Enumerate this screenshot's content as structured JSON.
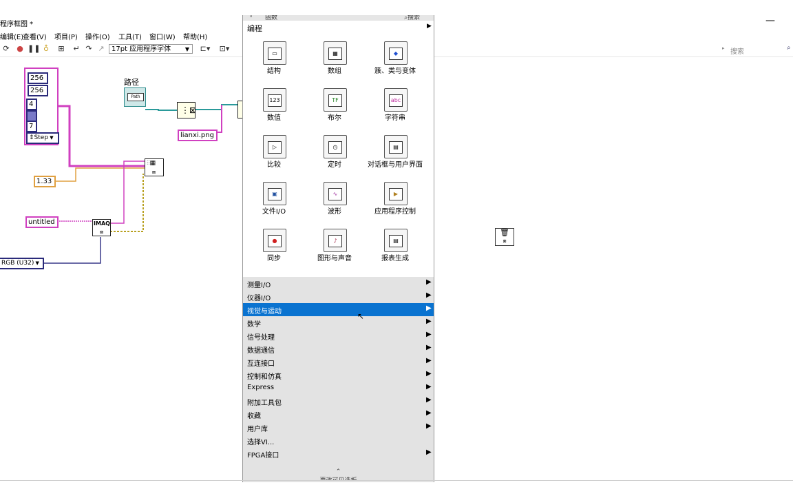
{
  "window": {
    "title": "程序框图 *",
    "minimize": "—"
  },
  "menu": [
    "编辑(E)",
    "查看(V)",
    "项目(P)",
    "操作(O)",
    "工具(T)",
    "窗口(W)",
    "帮助(H)"
  ],
  "toolbar": {
    "font": "17pt 应用程序字体",
    "search_placeholder": "搜索"
  },
  "diagram": {
    "cluster_values": [
      "256",
      "256",
      "4",
      "7"
    ],
    "step_label": "Step",
    "path_label": "路径",
    "path_node_text": "Path",
    "filename": "lianxi.png",
    "number": "1.33",
    "name": "untitled",
    "imaq": "IMAQ",
    "image_type": "RGB (U32)"
  },
  "palette": {
    "header": "函数",
    "header_search": "搜索",
    "category": "编程",
    "icons": [
      "结构",
      "数组",
      "簇、类与变体",
      "数值",
      "布尔",
      "字符串",
      "比较",
      "定时",
      "对话框与用户界面",
      "文件I/O",
      "波形",
      "应用程序控制",
      "同步",
      "图形与声音",
      "报表生成"
    ],
    "icon_glyphs": [
      "▭",
      "▦",
      "◆",
      "123",
      "TF",
      "abc",
      "▷",
      "◷",
      "▤",
      "▣",
      "∿",
      "▶",
      "●",
      "♪",
      "▤"
    ],
    "submenu": [
      "测量I/O",
      "仪器I/O",
      "视觉与运动",
      "数学",
      "信号处理",
      "数据通信",
      "互连接口",
      "控制和仿真",
      "Express",
      "附加工具包",
      "收藏",
      "用户库",
      "选择VI...",
      "FPGA接口"
    ],
    "more": "更改可见选板",
    "more_glyph": "⌃"
  }
}
